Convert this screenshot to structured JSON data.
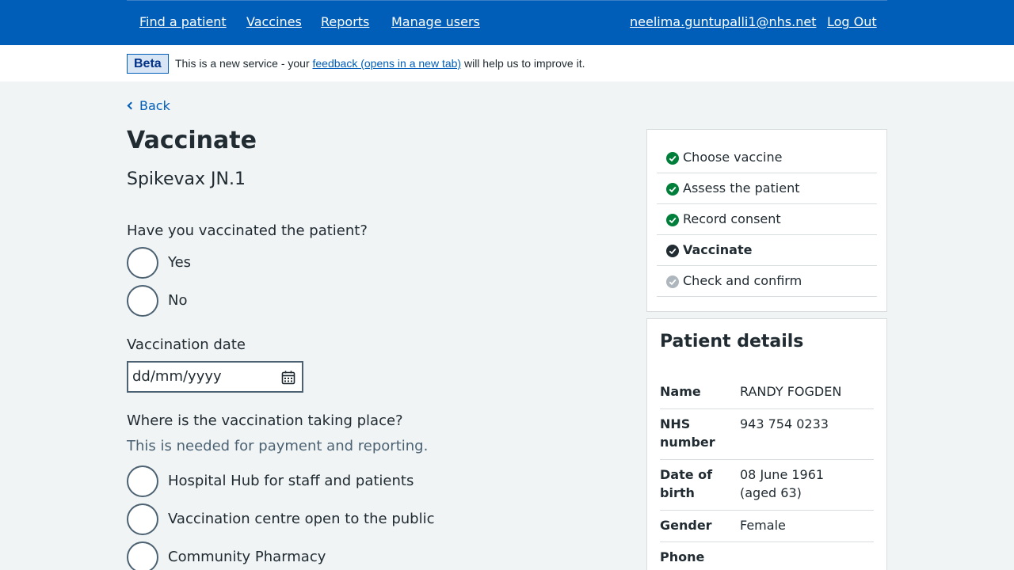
{
  "header": {
    "nav": [
      "Find a patient",
      "Vaccines",
      "Reports",
      "Manage users"
    ],
    "user_email": "neelima.guntupalli1@nhs.net",
    "logout": "Log Out"
  },
  "beta": {
    "tag": "Beta",
    "text_before": "This is a new service - your ",
    "link": "feedback (opens in a new tab)",
    "text_after": " will help us to improve it."
  },
  "back": "Back",
  "page": {
    "title": "Vaccinate",
    "vaccine": "Spikevax JN.1"
  },
  "form": {
    "vaccinated_question": "Have you vaccinated the patient?",
    "vaccinated_options": [
      "Yes",
      "No"
    ],
    "date_label": "Vaccination date",
    "date_placeholder": "dd/mm/yyyy",
    "location_question": "Where is the vaccination taking place?",
    "location_hint": "This is needed for payment and reporting.",
    "location_options": [
      "Hospital Hub for staff and patients",
      "Vaccination centre open to the public",
      "Community Pharmacy"
    ]
  },
  "tasks": [
    {
      "label": "Choose vaccine",
      "status": "done"
    },
    {
      "label": "Assess the patient",
      "status": "done"
    },
    {
      "label": "Record consent",
      "status": "done"
    },
    {
      "label": "Vaccinate",
      "status": "current"
    },
    {
      "label": "Check and confirm",
      "status": "pending"
    }
  ],
  "patient": {
    "heading": "Patient details",
    "rows": [
      {
        "key": "Name",
        "value": "RANDY FOGDEN"
      },
      {
        "key": "NHS number",
        "value": "943 754 0233"
      },
      {
        "key": "Date of birth",
        "value": "08 June 1961\n(aged 63)"
      },
      {
        "key": "Gender",
        "value": "Female"
      },
      {
        "key": "Phone number",
        "value": ""
      }
    ]
  },
  "colors": {
    "brand": "#005eb8",
    "done": "#007f3b",
    "current": "#212b32",
    "pending": "#aeb7bd"
  }
}
